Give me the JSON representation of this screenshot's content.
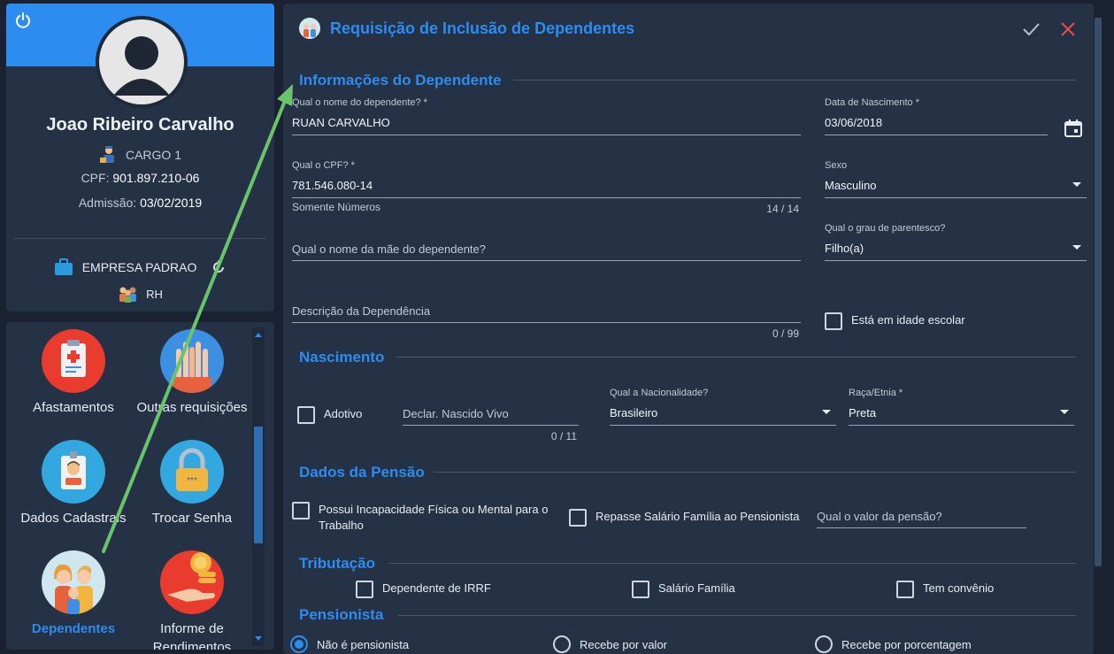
{
  "profile": {
    "name": "Joao Ribeiro Carvalho",
    "cargo": "CARGO 1",
    "cpf_label": "CPF:",
    "cpf_value": "901.897.210-06",
    "admissao_label": "Admissão:",
    "admissao_value": "03/02/2019",
    "empresa": "EMPRESA PADRAO",
    "setor": "RH"
  },
  "menu": {
    "items": [
      {
        "label": "Afastamentos",
        "icon": "medical-clipboard-icon"
      },
      {
        "label": "Outras requisições",
        "icon": "raised-hands-icon"
      },
      {
        "label": "Dados Cadastrais",
        "icon": "id-badge-icon"
      },
      {
        "label": "Trocar Senha",
        "icon": "padlock-icon"
      },
      {
        "label": "Dependentes",
        "icon": "family-icon"
      },
      {
        "label": "Informe de Rendimentos",
        "icon": "coin-hand-icon"
      }
    ]
  },
  "dialog": {
    "title": "Requisição de Inclusão de Dependentes",
    "sections": {
      "info": "Informações do Dependente",
      "nascimento": "Nascimento",
      "pensao": "Dados da Pensão",
      "tributacao": "Tributação",
      "pensionista": "Pensionista"
    },
    "fields": {
      "nome": {
        "label": "Qual o nome do dependente? *",
        "value": "RUAN CARVALHO"
      },
      "data_nasc": {
        "label": "Data de Nascimento *",
        "value": "03/06/2018"
      },
      "cpf": {
        "label": "Qual o CPF? *",
        "value": "781.546.080-14",
        "hint": "Somente Números",
        "counter": "14 / 14"
      },
      "sexo": {
        "label": "Sexo",
        "value": "Masculino"
      },
      "mae": {
        "placeholder": "Qual o nome da mãe do dependente?"
      },
      "grau": {
        "label": "Qual o grau de parentesco?",
        "value": "Filho(a)"
      },
      "descricao": {
        "placeholder": "Descrição da Dependência",
        "counter": "0 / 99"
      },
      "idade_escolar": "Está em idade escolar",
      "adotivo": "Adotivo",
      "declaracao": {
        "placeholder": "Declar. Nascido Vivo",
        "counter": "0 / 11"
      },
      "nacionalidade": {
        "label": "Qual a Nacionalidade?",
        "value": "Brasileiro"
      },
      "raca": {
        "label": "Raça/Etnia *",
        "value": "Preta"
      },
      "incapacidade": "Possui Incapacidade Física ou Mental para o Trabalho",
      "repasse": "Repasse Salário Família ao Pensionista",
      "valor_pensao": {
        "placeholder": "Qual o valor da pensão?"
      },
      "irrf": "Dependente de IRRF",
      "salario_familia": "Salário Família",
      "convenio": "Tem convênio"
    },
    "pensionista_options": [
      "Não é pensionista",
      "Recebe por valor",
      "Recebe por porcentagem"
    ],
    "pensionista_selected": "Não é pensionista"
  },
  "colors": {
    "accent": "#2d8cf0",
    "panel": "#253246",
    "background": "#1a2232",
    "arrow": "#6cc46a",
    "close": "#e84c4c"
  }
}
